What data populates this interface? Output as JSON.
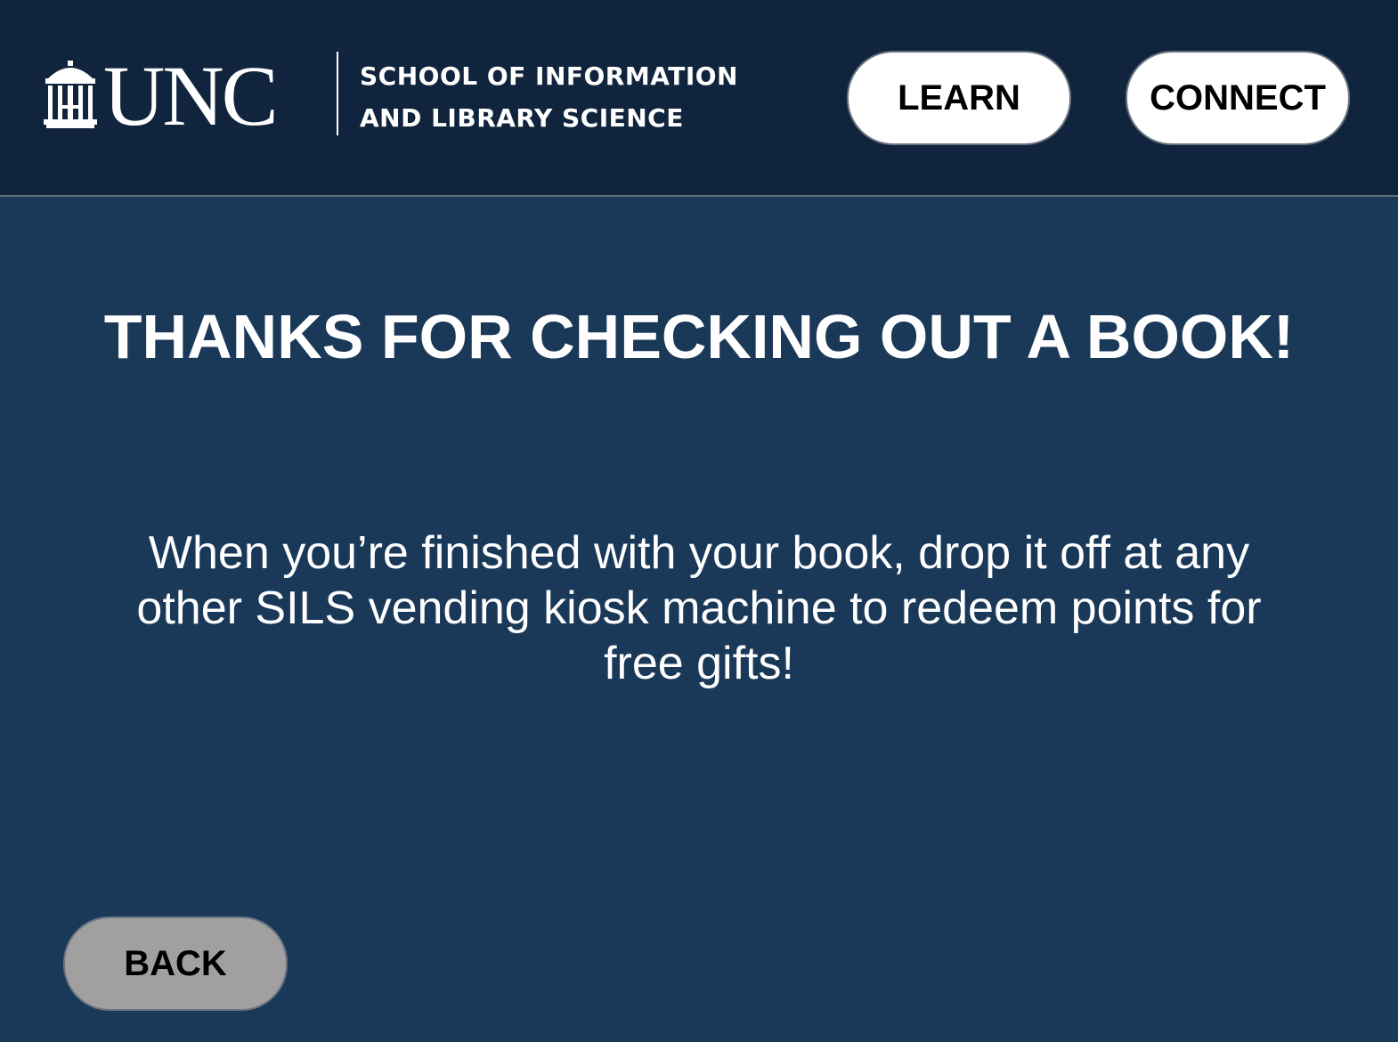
{
  "header": {
    "logo": {
      "wordmark": "UNC",
      "icon": "old-well-icon"
    },
    "school_name_line1": "SCHOOL OF INFORMATION",
    "school_name_line2": "AND LIBRARY SCIENCE",
    "nav": {
      "learn_label": "LEARN",
      "connect_label": "CONNECT"
    }
  },
  "main": {
    "headline": "THANKS FOR CHECKING OUT A BOOK!",
    "message": "When you’re finished with your book, drop it off at any other SILS vending kiosk machine to redeem points for free gifts!"
  },
  "footer": {
    "back_label": "BACK"
  },
  "colors": {
    "page_background": "#1a3858",
    "header_background": "#10253d",
    "nav_button_background": "#ffffff",
    "back_button_background": "#a0a0a0",
    "text": "#ffffff"
  }
}
